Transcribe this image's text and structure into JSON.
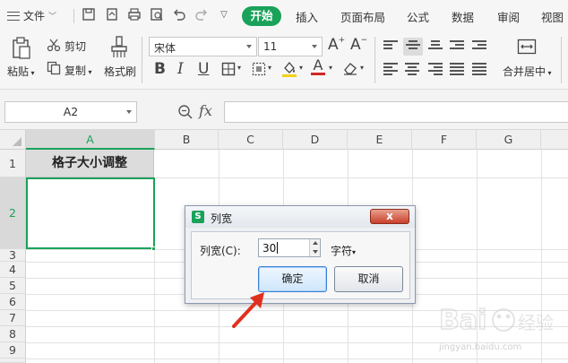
{
  "menubar": {
    "file_label": "文件",
    "tabs": [
      "开始",
      "插入",
      "页面布局",
      "公式",
      "数据",
      "审阅",
      "视图"
    ]
  },
  "ribbon": {
    "paste": "粘贴",
    "cut": "剪切",
    "copy": "复制",
    "format_painter": "格式刷",
    "font_name": "宋体",
    "font_size": "11",
    "merge_center": "合并居中"
  },
  "formula_bar": {
    "name_box": "A2",
    "fx": "fx",
    "formula": ""
  },
  "sheet": {
    "columns": [
      "A",
      "B",
      "C",
      "D",
      "E",
      "F",
      "G"
    ],
    "rows": [
      "1",
      "2",
      "3",
      "4",
      "5",
      "6",
      "7",
      "8",
      "9"
    ],
    "a1_value": "格子大小调整",
    "selected_cell": "A2"
  },
  "dialog": {
    "title": "列宽",
    "logo": "S",
    "close": "x",
    "field_label": "列宽(C):",
    "field_value": "30",
    "unit": "字符",
    "ok": "确定",
    "cancel": "取消"
  },
  "colors": {
    "accent": "#1aa25a",
    "annotation_arrow": "#e0301e"
  },
  "watermark": {
    "text": "jingyan.baidu.com"
  }
}
